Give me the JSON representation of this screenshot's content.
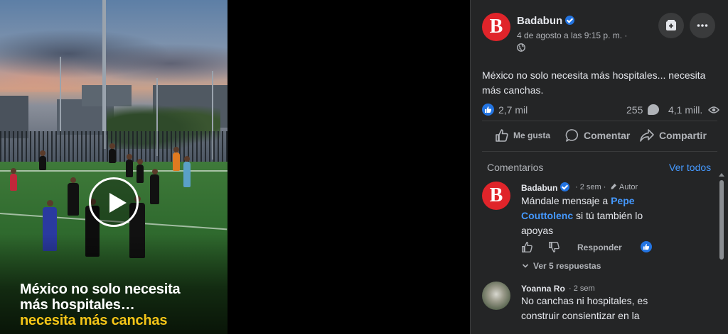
{
  "video": {
    "caption_line1": "México no solo necesita",
    "caption_line2": "más hospitales…",
    "caption_line3": "necesita más canchas",
    "caption_highlight_color": "#f5c518"
  },
  "post": {
    "author": "Badabun",
    "avatar_letter": "B",
    "timestamp": "4 de agosto a las 9:15 p. m. ·",
    "text": "México no solo necesita más hospitales... necesita más canchas.",
    "reactions_count": "2,7 mil",
    "comments_count": "255",
    "views_count": "4,1 mill.",
    "brand_color": "#e0242a",
    "accent_color": "#2374e1"
  },
  "actions": {
    "like": "Me gusta",
    "comment": "Comentar",
    "share": "Compartir"
  },
  "comments_section": {
    "header": "Comentarios",
    "see_all": "Ver todos",
    "comments": [
      {
        "author": "Badabun",
        "avatar_letter": "B",
        "time": "· 2 sem ·",
        "badge": "Autor",
        "text_before": "Mándale mensaje a",
        "mention": "Pepe Couttolenc",
        "text_after": "si tú también lo apoyas",
        "reply_label": "Responder",
        "view_replies": "Ver 5 respuestas"
      },
      {
        "author": "Yoanna Ro",
        "time": "· 2 sem",
        "text": "No canchas ni hospitales, es construir consientizar en la"
      }
    ]
  }
}
